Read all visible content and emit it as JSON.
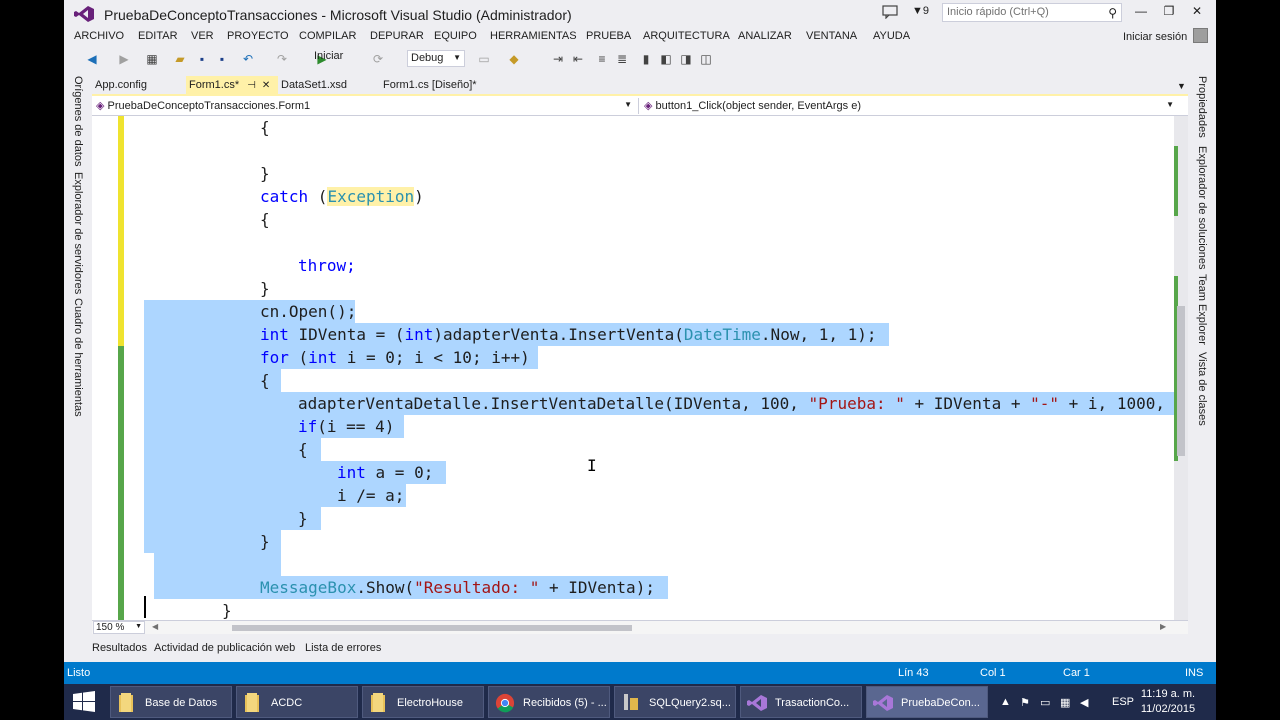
{
  "window": {
    "title": "PruebaDeConceptoTransacciones - Microsoft Visual Studio (Administrador)",
    "notification_count": "9",
    "quick_launch_placeholder": "Inicio rápido (Ctrl+Q)",
    "signin": "Iniciar sesión"
  },
  "menu": [
    "ARCHIVO",
    "EDITAR",
    "VER",
    "PROYECTO",
    "COMPILAR",
    "DEPURAR",
    "EQUIPO",
    "HERRAMIENTAS",
    "PRUEBA",
    "ARQUITECTURA",
    "ANALIZAR",
    "VENTANA",
    "AYUDA"
  ],
  "toolbar": {
    "start_label": "Iniciar",
    "config_value": "Debug"
  },
  "left_panels": [
    "Orígenes de datos",
    "Explorador de servidores",
    "Cuadro de herramientas"
  ],
  "right_panels": [
    "Propiedades",
    "Explorador de soluciones",
    "Team Explorer",
    "Vista de clases"
  ],
  "tabs": [
    "App.config",
    "Form1.cs*",
    "DataSet1.xsd",
    "Form1.cs [Diseño]*"
  ],
  "navbar": {
    "left": "PruebaDeConceptoTransacciones.Form1",
    "right": "button1_Click(object sender, EventArgs e)"
  },
  "code": {
    "l1": "{",
    "l2": "}",
    "l3_kw": "catch",
    "l3_open": " (",
    "l3_type": "Exception",
    "l3_close": ")",
    "l4": "{",
    "l5": "throw;",
    "l6": "}",
    "l7": "cn.Open();",
    "l8_kw1": "int",
    "l8_a": " IDVenta = (",
    "l8_kw2": "int",
    "l8_b": ")adapterVenta.InsertVenta(",
    "l8_type": "DateTime",
    "l8_c": ".Now, 1, 1);",
    "l9_kw1": "for",
    "l9_a": " (",
    "l9_kw2": "int",
    "l9_b": " i = 0; i < 10; i++)",
    "l10": "{",
    "l11_a": "adapterVentaDetalle.InsertVentaDetalle(IDVenta, 100, ",
    "l11_str1": "\"Prueba: \"",
    "l11_b": " + IDVenta + ",
    "l11_str2": "\"-\"",
    "l11_c": " + i, 1000,",
    "l12_kw": "if",
    "l12_a": "(i == 4)",
    "l13": "{",
    "l14_kw": "int",
    "l14_a": " a = 0;",
    "l15": "i /= a;",
    "l16": "}",
    "l17": "}",
    "l18_type": "MessageBox",
    "l18_a": ".Show(",
    "l18_str": "\"Resultado: \"",
    "l18_b": " + IDVenta);",
    "l19": "}"
  },
  "zoom": "150 %",
  "output_tabs": [
    "Resultados",
    "Actividad de publicación web",
    "Lista de errores"
  ],
  "status": {
    "ready": "Listo",
    "line": "Lín 43",
    "col": "Col 1",
    "car": "Car 1",
    "mode": "INS"
  },
  "taskbar": {
    "items": [
      "Base de Datos",
      "ACDC",
      "ElectroHouse",
      "Recibidos (5) - ...",
      "SQLQuery2.sq...",
      "TrasactionCo...",
      "PruebaDeCon..."
    ],
    "lang": "ESP",
    "time": "11:19 a. m.",
    "date": "11/02/2015"
  },
  "colors": {
    "accent": "#007acc",
    "selection": "#add6ff",
    "keyword": "#0000ff",
    "type": "#2b91af",
    "string": "#a31515",
    "active_tab": "#fff1a8"
  }
}
